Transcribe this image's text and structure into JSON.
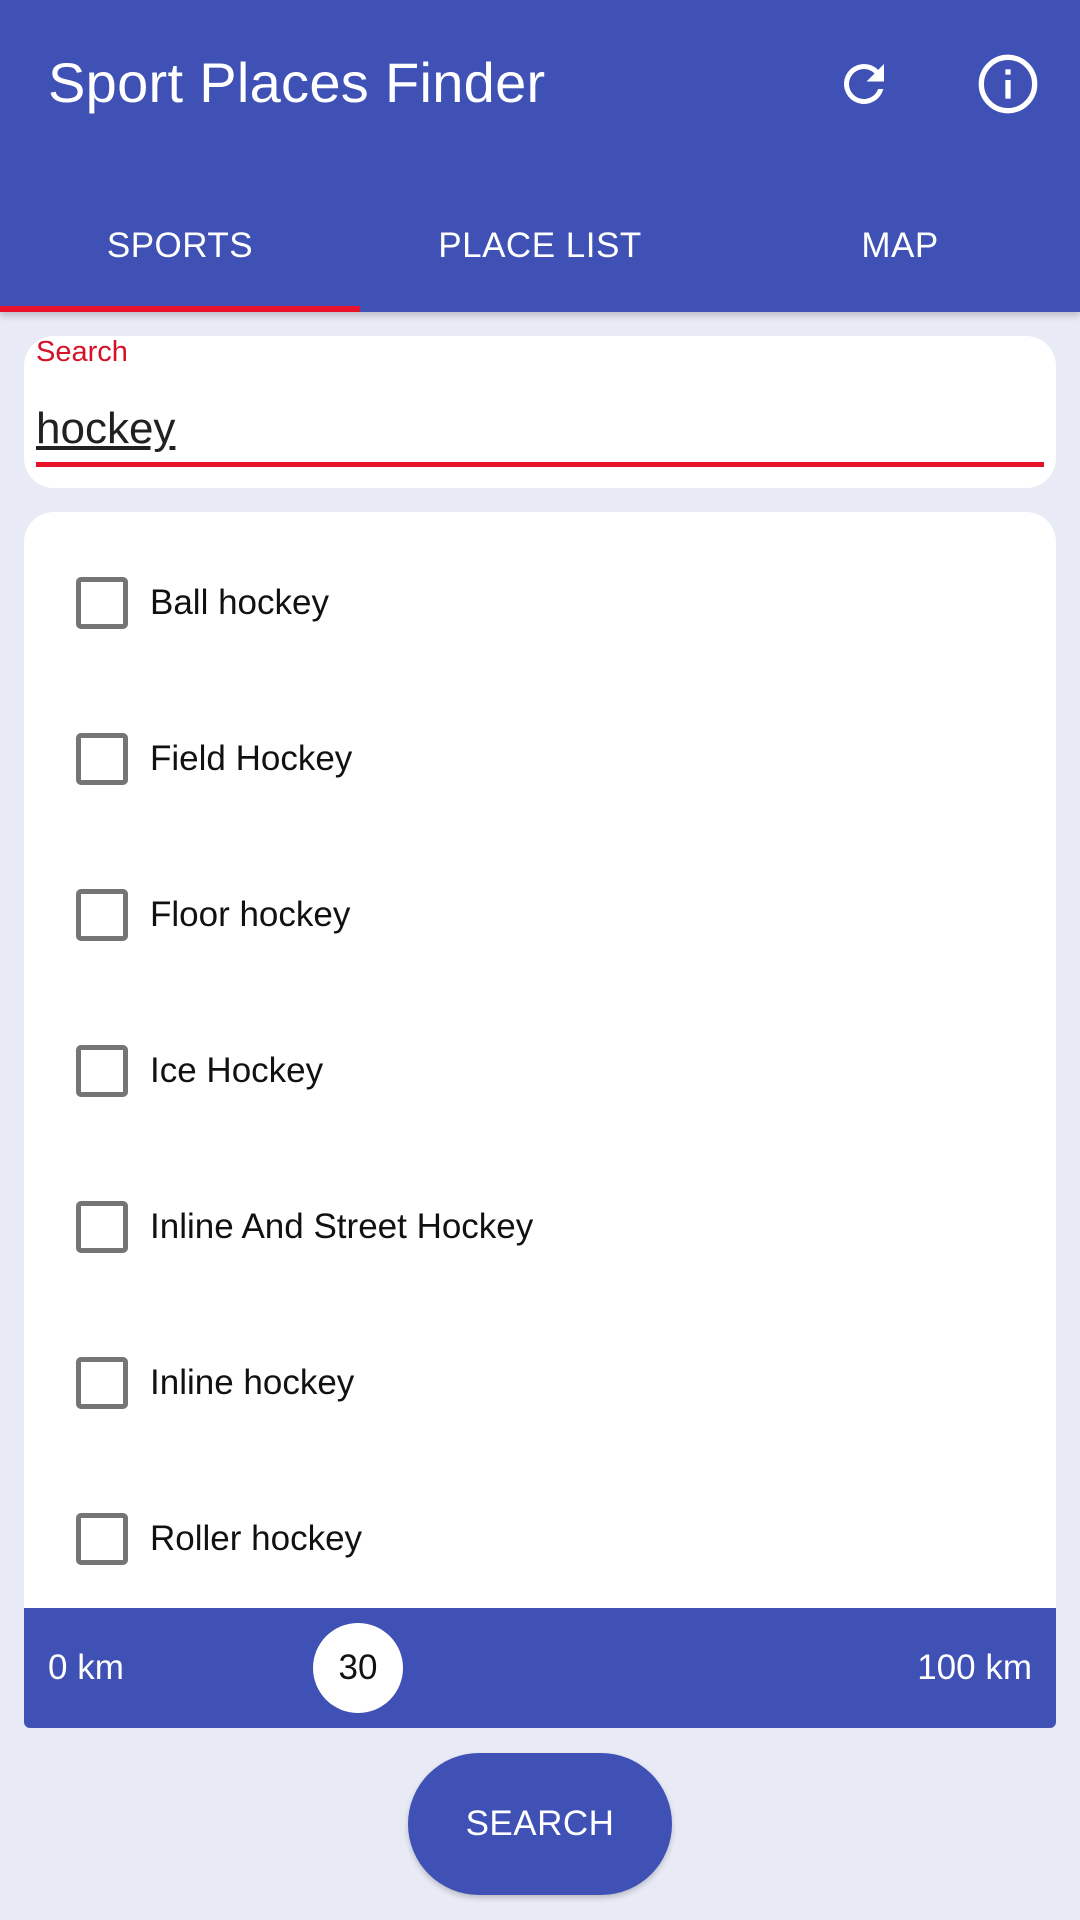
{
  "appbar": {
    "title": "Sport Places Finder",
    "refresh_icon": "refresh-icon",
    "info_icon": "info-icon"
  },
  "tabs": [
    {
      "label": "SPORTS",
      "active": true
    },
    {
      "label": "PLACE LIST",
      "active": false
    },
    {
      "label": "MAP",
      "active": false
    }
  ],
  "search": {
    "label": "Search",
    "value": "hockey"
  },
  "sports": [
    {
      "label": "Ball hockey",
      "checked": false
    },
    {
      "label": "Field Hockey",
      "checked": false
    },
    {
      "label": "Floor hockey",
      "checked": false
    },
    {
      "label": "Ice Hockey",
      "checked": false
    },
    {
      "label": "Inline And Street Hockey",
      "checked": false
    },
    {
      "label": "Inline hockey",
      "checked": false
    },
    {
      "label": "Roller hockey",
      "checked": false
    }
  ],
  "distance": {
    "min_label": "0 km",
    "max_label": "100 km",
    "value": "30"
  },
  "search_button": {
    "label": "SEARCH"
  },
  "colors": {
    "primary": "#3F51B5",
    "accent": "#E8132B",
    "background": "#E8EAF6"
  }
}
